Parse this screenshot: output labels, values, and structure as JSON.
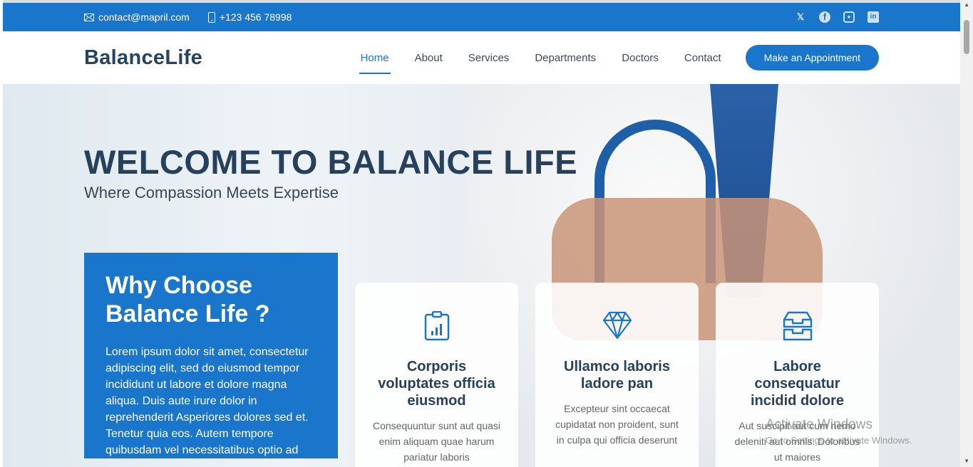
{
  "topbar": {
    "email": "contact@mapril.com",
    "phone": "+123 456 78998",
    "social": [
      "x-icon",
      "facebook-icon",
      "instagram-icon",
      "linkedin-icon"
    ]
  },
  "header": {
    "logo": "BalanceLife",
    "nav": [
      "Home",
      "About",
      "Services",
      "Departments",
      "Doctors",
      "Contact"
    ],
    "cta": "Make an Appointment"
  },
  "hero": {
    "title": "WELCOME TO BALANCE LIFE",
    "subtitle": "Where Compassion Meets Expertise"
  },
  "why": {
    "title": "Why Choose Balance Life ?",
    "text": "Lorem ipsum dolor sit amet, consectetur adipiscing elit, sed do eiusmod tempor incididunt ut labore et dolore magna aliqua. Duis aute irure dolor in reprehenderit Asperiores dolores sed et. Tenetur quia eos. Autem tempore quibusdam vel necessitatibus optio ad"
  },
  "cards": [
    {
      "title": "Corporis voluptates officia eiusmod",
      "text": "Consequuntur sunt aut quasi enim aliquam quae harum pariatur laboris"
    },
    {
      "title": "Ullamco laboris ladore pan",
      "text": "Excepteur sint occaecat cupidatat non proident, sunt in culpa qui officia deserunt"
    },
    {
      "title": "Labore consequatur incidid dolore",
      "text": "Aut suscipit aut cum nemo deleniti aut omnis. Doloribus ut maiores"
    }
  ],
  "watermark": {
    "line1": "Activate Windows",
    "line2": "Go to Settings to activate Windows."
  },
  "colors": {
    "brand": "#1a76cb",
    "heading": "#27415c"
  }
}
